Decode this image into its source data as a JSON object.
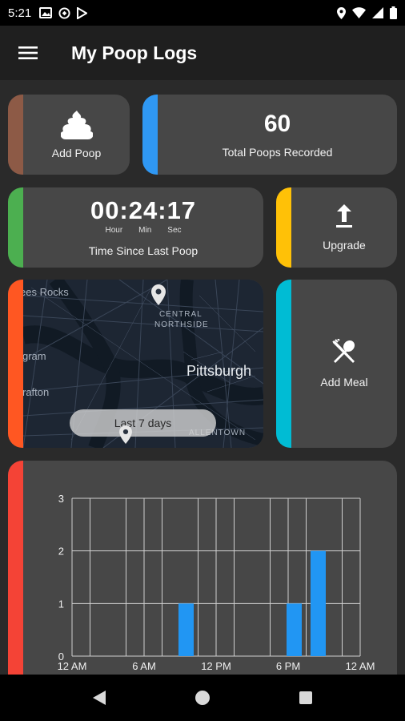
{
  "status_bar": {
    "time": "5:21"
  },
  "app_bar": {
    "title": "My Poop Logs"
  },
  "cards": {
    "add_poop": {
      "label": "Add Poop",
      "accent": "#8d5a46"
    },
    "total": {
      "value": "60",
      "label": "Total Poops Recorded",
      "accent": "#2f98f4"
    },
    "timer": {
      "value": "00:24:17",
      "units": [
        "Hour",
        "Min",
        "Sec"
      ],
      "label": "Time Since Last Poop",
      "accent": "#4caf50"
    },
    "upgrade": {
      "label": "Upgrade",
      "accent": "#ffc107"
    },
    "map": {
      "pill_label": "Last 7 days",
      "places": [
        "ees Rocks",
        "CENTRAL",
        "NORTHSIDE",
        "Pittsburgh",
        "gram",
        "rafton",
        "ALLENTOWN"
      ],
      "accent": "#ff5722"
    },
    "meal": {
      "label": "Add Meal",
      "accent": "#00bcd4"
    },
    "chart": {
      "accent": "#f44336"
    }
  },
  "chart_data": {
    "type": "bar",
    "x_tick_labels": [
      "12 AM",
      "6 AM",
      "12 PM",
      "6 PM",
      "12 AM"
    ],
    "x_range_hours": [
      0,
      24
    ],
    "bars": [
      {
        "hour": 9.5,
        "value": 1
      },
      {
        "hour": 18.5,
        "value": 1
      },
      {
        "hour": 20.5,
        "value": 2
      }
    ],
    "ylim": [
      0,
      3
    ],
    "y_ticks": [
      0,
      1,
      2,
      3
    ],
    "grid": true,
    "bar_color": "#2196f3"
  }
}
